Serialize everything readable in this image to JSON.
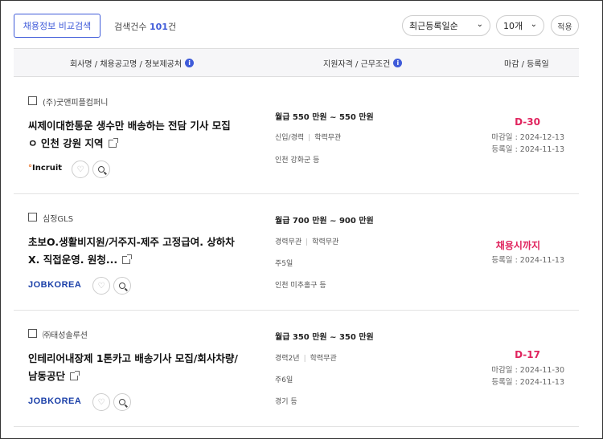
{
  "toolbar": {
    "compare_label": "채용정보 비교검색",
    "count_prefix": "검색건수",
    "count_value": "101",
    "count_suffix": "건",
    "sort_selected": "최근등록일순",
    "per_page_selected": "10개",
    "apply_label": "적용"
  },
  "table_header": {
    "col1": "회사명 / 채용공고명 / 정보제공처",
    "col2": "지원자격 / 근무조건",
    "col3": "마감 / 등록일"
  },
  "jobs": [
    {
      "company": "(주)굿앤피플컴퍼니",
      "title_line1": "씨제이대한통운 생수만 배송하는 전담 기사 모집",
      "title_line2": "ㅇ 인천 강원 지역",
      "source": "Incruit",
      "salary": "월급 550 만원 ~ 550 만원",
      "career": "신입/경력",
      "education": "학력무관",
      "workdays": "",
      "location": "인천 강화군 등",
      "deadline_badge": "D-30",
      "deadline_date": "마감일 : 2024-12-13",
      "registered_date": "등록일 : 2024-11-13"
    },
    {
      "company": "심정GLS",
      "title_line1": "초보O.생활비지원/거주지-제주 고정급여. 상하차",
      "title_line2": "X. 직접운영. 원청...",
      "source": "JOBKOREA",
      "salary": "월급 700 만원 ~ 900 만원",
      "career": "경력무관",
      "education": "학력무관",
      "workdays": "주5일",
      "location": "인천 미추홀구 등",
      "deadline_badge": "채용시까지",
      "deadline_date": "",
      "registered_date": "등록일 : 2024-11-13"
    },
    {
      "company": "㈜태성솔루션",
      "title_line1": "인테리어내장제 1톤카고 배송기사 모집/회사차량/",
      "title_line2": "남동공단",
      "source": "JOBKOREA",
      "salary": "월급 350 만원 ~ 350 만원",
      "career": "경력2년",
      "education": "학력무관",
      "workdays": "주6일",
      "location": "경기 등",
      "deadline_badge": "D-17",
      "deadline_date": "마감일 : 2024-11-30",
      "registered_date": "등록일 : 2024-11-13"
    }
  ],
  "colors": {
    "accent": "#3f5bd9",
    "deadline": "#e0245e"
  }
}
